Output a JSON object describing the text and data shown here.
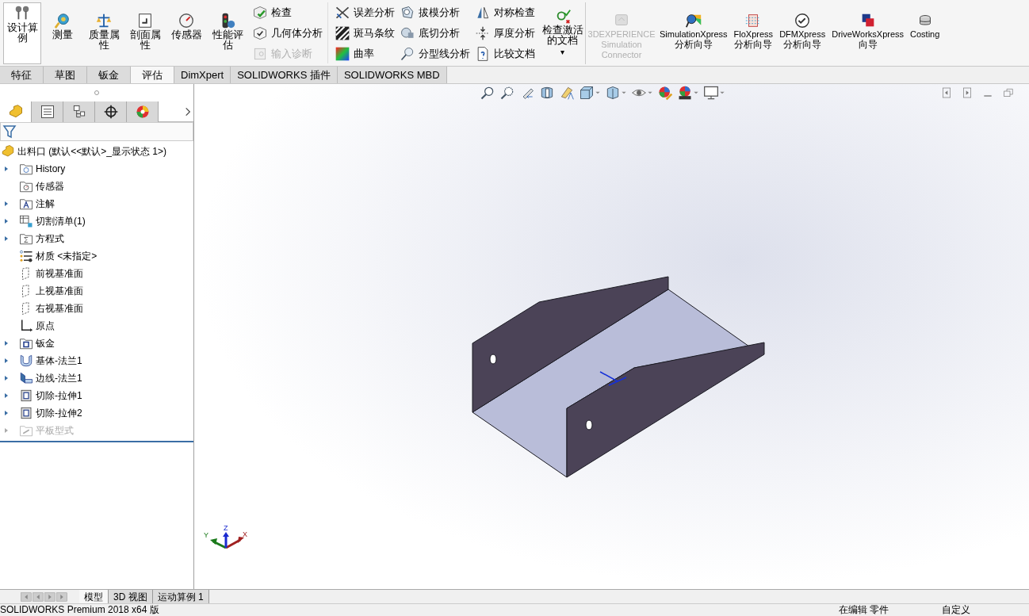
{
  "ribbon": {
    "big_buttons": [
      {
        "kind": "design",
        "label": "设计算例",
        "disabled": false
      },
      {
        "kind": "measure",
        "label": "测量",
        "disabled": false
      },
      {
        "kind": "mass",
        "label": "质量属性",
        "disabled": false
      },
      {
        "kind": "section",
        "label": "剖面属性",
        "disabled": false
      },
      {
        "kind": "sensor",
        "label": "传感器",
        "disabled": false
      },
      {
        "kind": "perf",
        "label": "性能评估",
        "disabled": false
      }
    ],
    "small_columns": [
      [
        {
          "kind": "check",
          "label": "检查",
          "disabled": false
        },
        {
          "kind": "geom",
          "label": "几何体分析",
          "disabled": false
        },
        {
          "kind": "import",
          "label": "输入诊断",
          "disabled": true
        }
      ],
      [
        {
          "kind": "deviation",
          "label": "误差分析",
          "disabled": false
        },
        {
          "kind": "zebra",
          "label": "斑马条纹",
          "disabled": false
        },
        {
          "kind": "curvature",
          "label": "曲率",
          "disabled": false
        }
      ],
      [
        {
          "kind": "draft",
          "label": "拔模分析",
          "disabled": false
        },
        {
          "kind": "undercut",
          "label": "底切分析",
          "disabled": false
        },
        {
          "kind": "parting",
          "label": "分型线分析",
          "disabled": false
        }
      ],
      [
        {
          "kind": "symmetry",
          "label": "对称检查",
          "disabled": false
        },
        {
          "kind": "thickness",
          "label": "厚度分析",
          "disabled": false
        },
        {
          "kind": "compare",
          "label": "比较文档",
          "disabled": false
        }
      ]
    ],
    "active_doc": {
      "label": "检查激活的文档",
      "caret": "▾"
    },
    "addins": [
      {
        "kind": "connector",
        "label": "3DEXPERIENCE Simulation Connector",
        "disabled": true
      },
      {
        "kind": "sim",
        "label": "SimulationXpress 分析向导",
        "disabled": false
      },
      {
        "kind": "flo",
        "label": "FloXpress 分析向导",
        "disabled": false
      },
      {
        "kind": "dfm",
        "label": "DFMXpress 分析向导",
        "disabled": false
      },
      {
        "kind": "drive",
        "label": "DriveWorksXpress 向导",
        "disabled": false
      },
      {
        "kind": "cost",
        "label": "Costing",
        "disabled": false
      }
    ]
  },
  "tabs": [
    {
      "label": "特征",
      "selected": false
    },
    {
      "label": "草图",
      "selected": false
    },
    {
      "label": "钣金",
      "selected": false
    },
    {
      "label": "评估",
      "selected": true
    },
    {
      "label": "DimXpert",
      "selected": false
    },
    {
      "label": "SOLIDWORKS 插件",
      "selected": false
    },
    {
      "label": "SOLIDWORKS MBD",
      "selected": false
    }
  ],
  "panel_tabs": [
    {
      "kind": "feature",
      "selected": true
    },
    {
      "kind": "property",
      "selected": false
    },
    {
      "kind": "config",
      "selected": false
    },
    {
      "kind": "dim",
      "selected": false
    },
    {
      "kind": "display",
      "selected": false
    }
  ],
  "tree": {
    "root": "出料口  (默认<<默认>_显示状态 1>)",
    "items": [
      {
        "kind": "history",
        "label": "History",
        "expandable": true,
        "disabled": false
      },
      {
        "kind": "sensor",
        "label": "传感器",
        "expandable": false,
        "disabled": false
      },
      {
        "kind": "annotation",
        "label": "注解",
        "expandable": true,
        "disabled": false
      },
      {
        "kind": "cutlist",
        "label": "切割清单(1)",
        "expandable": true,
        "disabled": false
      },
      {
        "kind": "equation",
        "label": "方程式",
        "expandable": true,
        "disabled": false
      },
      {
        "kind": "material",
        "label": "材质 <未指定>",
        "expandable": false,
        "disabled": false
      },
      {
        "kind": "plane",
        "label": "前视基准面",
        "expandable": false,
        "disabled": false
      },
      {
        "kind": "plane",
        "label": "上视基准面",
        "expandable": false,
        "disabled": false
      },
      {
        "kind": "plane",
        "label": "右视基准面",
        "expandable": false,
        "disabled": false
      },
      {
        "kind": "origin",
        "label": "原点",
        "expandable": false,
        "disabled": false
      },
      {
        "kind": "sheetmetal",
        "label": "钣金",
        "expandable": true,
        "disabled": false
      },
      {
        "kind": "baseflange",
        "label": "基体-法兰1",
        "expandable": true,
        "disabled": false
      },
      {
        "kind": "edgeflange",
        "label": "边线-法兰1",
        "expandable": true,
        "disabled": false
      },
      {
        "kind": "cut",
        "label": "切除-拉伸1",
        "expandable": true,
        "disabled": false
      },
      {
        "kind": "cut",
        "label": "切除-拉伸2",
        "expandable": true,
        "disabled": false
      },
      {
        "kind": "flat",
        "label": "平板型式",
        "expandable": true,
        "disabled": true
      }
    ]
  },
  "triad": {
    "x": "X",
    "y": "Y",
    "z": "Z"
  },
  "bottom_tabs": [
    {
      "label": "模型",
      "selected": true
    },
    {
      "label": "3D 视图",
      "selected": false
    },
    {
      "label": "运动算例 1",
      "selected": false
    }
  ],
  "status_bar": {
    "left": "SOLIDWORKS Premium 2018 x64 版",
    "mode": "在编辑 零件",
    "units": "自定义"
  }
}
